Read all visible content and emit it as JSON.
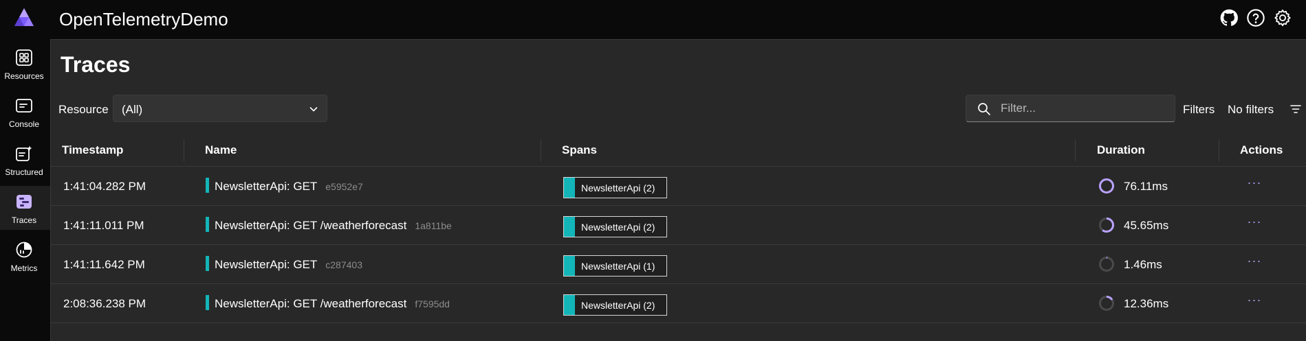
{
  "header": {
    "app_title": "OpenTelemetryDemo",
    "icons": [
      "github-icon",
      "help-icon",
      "settings-icon"
    ]
  },
  "sidebar": {
    "items": [
      {
        "label": "Resources",
        "icon": "resources-icon",
        "active": false
      },
      {
        "label": "Console",
        "icon": "console-icon",
        "active": false
      },
      {
        "label": "Structured",
        "icon": "structured-icon",
        "active": false
      },
      {
        "label": "Traces",
        "icon": "traces-icon",
        "active": true
      },
      {
        "label": "Metrics",
        "icon": "metrics-icon",
        "active": false
      }
    ]
  },
  "page": {
    "title": "Traces",
    "resource_label": "Resource",
    "resource_value": "(All)",
    "filter_placeholder": "Filter...",
    "filters_label": "Filters",
    "filters_status": "No filters"
  },
  "table": {
    "columns": [
      "Timestamp",
      "Name",
      "Spans",
      "Duration",
      "Actions"
    ],
    "rows": [
      {
        "timestamp": "1:41:04.282 PM",
        "name": "NewsletterApi: GET",
        "trace_id": "e5952e7",
        "spans": "NewsletterApi (2)",
        "duration": "76.11ms",
        "duration_fraction": 1.0
      },
      {
        "timestamp": "1:41:11.011 PM",
        "name": "NewsletterApi: GET /weatherforecast",
        "trace_id": "1a811be",
        "spans": "NewsletterApi (2)",
        "duration": "45.65ms",
        "duration_fraction": 0.6
      },
      {
        "timestamp": "1:41:11.642 PM",
        "name": "NewsletterApi: GET",
        "trace_id": "c287403",
        "spans": "NewsletterApi (1)",
        "duration": "1.46ms",
        "duration_fraction": 0.02
      },
      {
        "timestamp": "2:08:36.238 PM",
        "name": "NewsletterApi: GET /weatherforecast",
        "trace_id": "f7595dd",
        "spans": "NewsletterApi (2)",
        "duration": "12.36ms",
        "duration_fraction": 0.16
      }
    ]
  },
  "colors": {
    "accent": "#b9a2ff",
    "span_fill": "#13b5b8",
    "background": "#282828",
    "chrome": "#0a0a0a"
  }
}
